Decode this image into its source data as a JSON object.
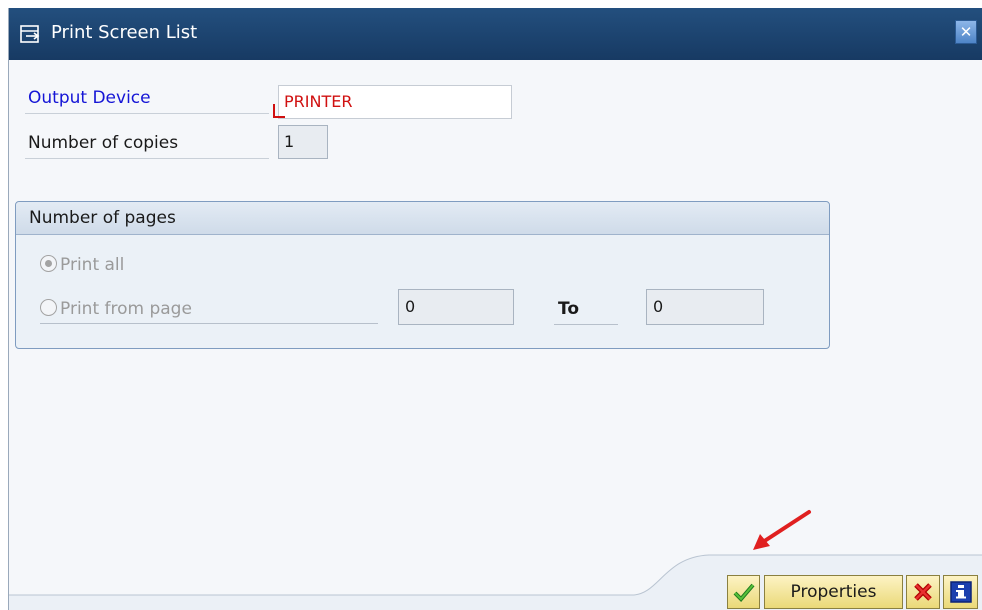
{
  "window": {
    "title": "Print Screen List",
    "close_icon": "close-x-icon"
  },
  "form": {
    "output_device_label": "Output Device",
    "output_device_value": "PRINTER",
    "copies_label": "Number of copies",
    "copies_value": "1"
  },
  "pages_group": {
    "title": "Number of pages",
    "print_all_label": "Print all",
    "print_all_selected": true,
    "print_from_label": "Print from page",
    "print_from_selected": false,
    "from_value": "0",
    "to_label": "To",
    "to_value": "0"
  },
  "footer": {
    "ok_icon": "checkmark-icon",
    "properties_label": "Properties",
    "cancel_icon": "red-x-icon",
    "info_icon": "info-icon"
  },
  "colors": {
    "titlebar": "#1f4a78",
    "required_label": "#1515d6",
    "required_value": "#d01010",
    "button_bg": "#f5e8a2",
    "annotation_arrow": "#e02020"
  }
}
